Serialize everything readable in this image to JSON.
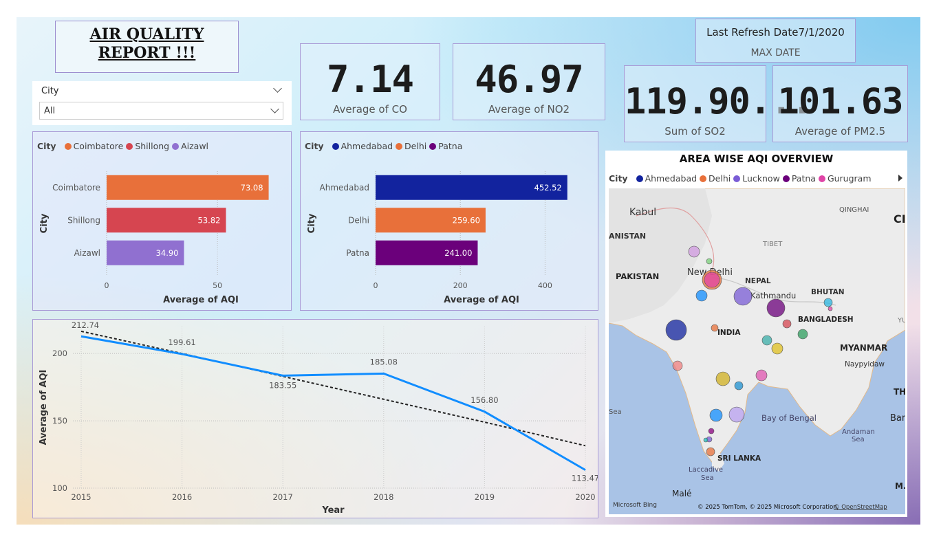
{
  "report_title": {
    "line1": "AIR QUALITY ",
    "line2": "REPORT !!!"
  },
  "slicer": {
    "label": "City",
    "value": "All"
  },
  "kpis": {
    "co": {
      "value": "7.14",
      "caption": "Average of CO"
    },
    "no2": {
      "value": "46.97",
      "caption": "Average of NO2"
    },
    "so2": {
      "value": "119.90...",
      "caption": "Sum of SO2"
    },
    "pm25": {
      "value": "101.63",
      "caption": "Average of PM2.5"
    }
  },
  "refresh": {
    "label": "Last Refresh Date7/1/2020",
    "sub": "MAX DATE"
  },
  "chart_data": [
    {
      "type": "bar",
      "orientation": "horizontal",
      "legend_title": "City",
      "categories": [
        "Coimbatore",
        "Shillong",
        "Aizawl"
      ],
      "values": [
        73.08,
        53.82,
        34.9
      ],
      "value_labels": [
        "73.08",
        "53.82",
        "34.90"
      ],
      "colors": [
        "#E8703A",
        "#D64550",
        "#9070D0"
      ],
      "xlabel": "Average of AQI",
      "ylabel": "City",
      "xlim": [
        0,
        85
      ],
      "xticks": [
        "0",
        "50"
      ],
      "xtick_values": [
        0,
        50
      ],
      "legend": "top-left"
    },
    {
      "type": "bar",
      "orientation": "horizontal",
      "legend_title": "City",
      "categories": [
        "Ahmedabad",
        "Delhi",
        "Patna"
      ],
      "values": [
        452.52,
        259.6,
        241.0
      ],
      "value_labels": [
        "452.52",
        "259.60",
        "241.00"
      ],
      "colors": [
        "#12239E",
        "#E8703A",
        "#6B007B"
      ],
      "xlabel": "Average of AQI",
      "ylabel": "City",
      "xlim": [
        0,
        500
      ],
      "xticks": [
        "0",
        "200",
        "400"
      ],
      "xtick_values": [
        0,
        200,
        400
      ],
      "legend": "top-left"
    },
    {
      "type": "line",
      "x": [
        "2015",
        "2016",
        "2017",
        "2018",
        "2019",
        "2020"
      ],
      "values": [
        212.74,
        199.61,
        183.55,
        185.08,
        156.8,
        113.47
      ],
      "value_labels": [
        "212.74",
        "199.61",
        "183.55",
        "185.08",
        "156.80",
        "113.47"
      ],
      "trend": [
        216.5,
        200.0,
        183.0,
        166.0,
        149.0,
        131.5
      ],
      "xlabel": "Year",
      "ylabel": "Average of AQI",
      "ylim": [
        100,
        220
      ],
      "yticks": [
        "100",
        "150",
        "200"
      ],
      "ytick_values": [
        100,
        150,
        200
      ],
      "line_color": "#118DFF",
      "trend_color": "#222222",
      "grid": true
    }
  ],
  "map": {
    "title": "AREA WISE AQI OVERVIEW",
    "legend_title": "City",
    "legend": [
      {
        "name": "Ahmedabad",
        "color": "#12239E"
      },
      {
        "name": "Delhi",
        "color": "#E8703A"
      },
      {
        "name": "Lucknow",
        "color": "#7A5CD6"
      },
      {
        "name": "Patna",
        "color": "#6B007B"
      },
      {
        "name": "Gurugram",
        "color": "#E044A7"
      }
    ],
    "more_icon": "triangle-right-icon",
    "places": [
      "Kabul",
      "ANISTAN",
      "QINGHAI",
      "CI",
      "TIBET",
      "PAKISTAN",
      "New Delhi",
      "NEPAL",
      "Kathmandu",
      "BHUTAN",
      "BANGLADESH",
      "INDIA",
      "MYANMAR",
      "Naypyidaw",
      "THA",
      "Sea",
      "Bay of Bengal",
      "Bang",
      "Andaman",
      "Sea",
      "SRI LANKA",
      "Laccadive",
      "Sea",
      "Malé",
      "M.",
      "YU"
    ],
    "logo": "Microsoft Bing",
    "credits": "© 2025 TomTom, © 2025 Microsoft Corporation,",
    "credits_link": "© OpenStreetMap"
  }
}
